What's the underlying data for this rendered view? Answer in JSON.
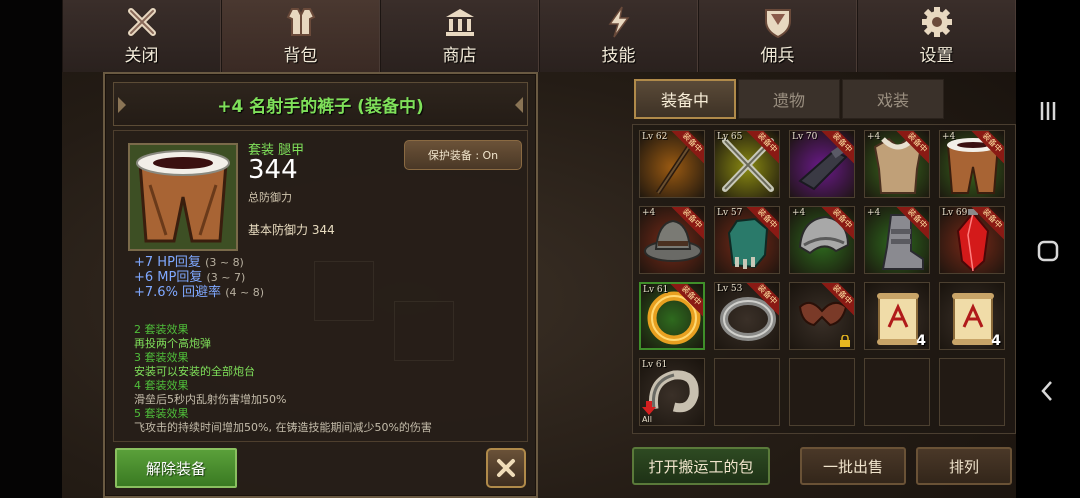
{
  "nav": {
    "tabs": [
      {
        "label": "关闭",
        "icon": "close-icon"
      },
      {
        "label": "背包",
        "icon": "vest-icon"
      },
      {
        "label": "商店",
        "icon": "shop-icon"
      },
      {
        "label": "技能",
        "icon": "skill-icon"
      },
      {
        "label": "佣兵",
        "icon": "shield-icon"
      },
      {
        "label": "设置",
        "icon": "gear-icon"
      }
    ],
    "active_index": 1
  },
  "detail": {
    "title": "+4 名射手的裤子 (装备中)",
    "slot_label": "套装 腿甲",
    "defense_value": "344",
    "defense_label": "总防御力",
    "base_defense": "基本防御力 344",
    "protect_button": "保护装备 : On",
    "stats": [
      {
        "text": "+7 HP回复",
        "range": "(3 ~ 8)"
      },
      {
        "text": "+6 MP回复",
        "range": "(3 ~ 7)"
      },
      {
        "text": "+7.6% 回避率",
        "range": "(4 ~ 8)"
      }
    ],
    "set_effects": [
      {
        "header": "2 套装效果",
        "desc": "再投两个高炮弹",
        "active": true
      },
      {
        "header": "3 套装效果",
        "desc": "安装可以安装的全部炮台",
        "active": true
      },
      {
        "header": "4 套装效果",
        "desc": "滑垒后5秒内乱射伤害增加50%",
        "active": false
      },
      {
        "header": "5 套装效果",
        "desc": "飞攻击的持续时间增加50%, 在铸造技能期间减少50%的伤害",
        "active": false
      }
    ],
    "unequip_button": "解除装备"
  },
  "inventory": {
    "tabs": [
      "装备中",
      "遗物",
      "戏装"
    ],
    "active_tab": 0,
    "equipped_badge": "装备中",
    "slots": [
      {
        "lv": "Lv 62",
        "equipped": true,
        "art": "staff",
        "bg": "#9a5a12"
      },
      {
        "lv": "Lv 65",
        "equipped": true,
        "art": "daggers",
        "bg": "#8a8a12"
      },
      {
        "lv": "Lv 70",
        "equipped": true,
        "art": "gun",
        "bg": "#6a1a8a"
      },
      {
        "lv": "+4",
        "equipped": true,
        "art": "armor",
        "bg": "#3a6a1e"
      },
      {
        "lv": "+4",
        "equipped": true,
        "art": "pants",
        "bg": "#3a6a1e"
      },
      {
        "lv": "+4",
        "equipped": true,
        "art": "hat",
        "bg": "#7a2a18"
      },
      {
        "lv": "Lv 57",
        "equipped": true,
        "art": "glove",
        "bg": "#7a2a18"
      },
      {
        "lv": "+4",
        "equipped": true,
        "art": "helm",
        "bg": "#2e6a1e"
      },
      {
        "lv": "+4",
        "equipped": true,
        "art": "boot",
        "bg": "#2e6a1e"
      },
      {
        "lv": "Lv 69",
        "equipped": true,
        "art": "gem",
        "bg": "#7a2a18"
      },
      {
        "lv": "Lv 61",
        "equipped": true,
        "art": "ring-gold",
        "bg": "#2e6a1e",
        "green": true
      },
      {
        "lv": "Lv 53",
        "equipped": true,
        "art": "ring-silver",
        "bg": "#3a3028"
      },
      {
        "lv": "",
        "equipped": true,
        "art": "wings",
        "bg": "#3a3028",
        "locked": true
      },
      {
        "lv": "",
        "equipped": false,
        "art": "scroll",
        "bg": "#3a3028",
        "count": "4"
      },
      {
        "lv": "",
        "equipped": false,
        "art": "scroll",
        "bg": "#3a3028",
        "count": "4"
      },
      {
        "lv": "Lv 61",
        "equipped": false,
        "art": "horn",
        "bg": "#3a3028",
        "down": true,
        "tag": "All"
      },
      {
        "lv": "",
        "equipped": false,
        "art": "",
        "bg": ""
      },
      {
        "lv": "",
        "equipped": false,
        "art": "",
        "bg": ""
      },
      {
        "lv": "",
        "equipped": false,
        "art": "",
        "bg": ""
      },
      {
        "lv": "",
        "equipped": false,
        "art": "",
        "bg": ""
      }
    ],
    "open_pack_button": "打开搬运工的包",
    "bulk_sell_button": "一批出售",
    "sort_button": "排列"
  },
  "colors": {
    "accent_green": "#7fe05a",
    "stat_blue": "#7fa8ff",
    "panel_border": "#6a5a42"
  }
}
